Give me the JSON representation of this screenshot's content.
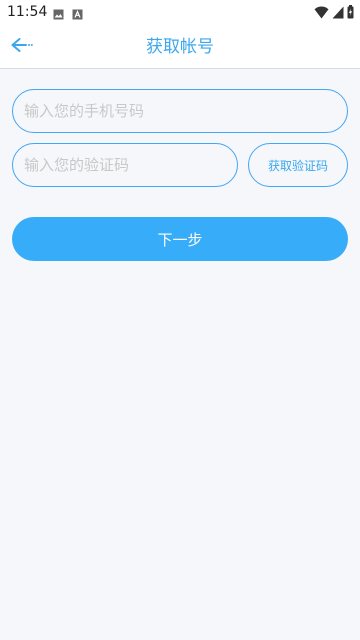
{
  "status_bar": {
    "time": "11:54",
    "left_icons": [
      "image-icon",
      "a-icon"
    ],
    "right_icons": [
      "wifi-icon",
      "signal-icon",
      "battery-icon"
    ]
  },
  "header": {
    "title": "获取帐号",
    "back_icon": "back-arrow-icon"
  },
  "form": {
    "phone_placeholder": "输入您的手机号码",
    "phone_value": "",
    "code_placeholder": "输入您的验证码",
    "code_value": "",
    "send_code_label": "获取验证码",
    "next_label": "下一步"
  },
  "colors": {
    "accent": "#37acf9",
    "accent_text": "#3aa7ee",
    "border": "#42a5f5",
    "background": "#f5f7fa"
  }
}
